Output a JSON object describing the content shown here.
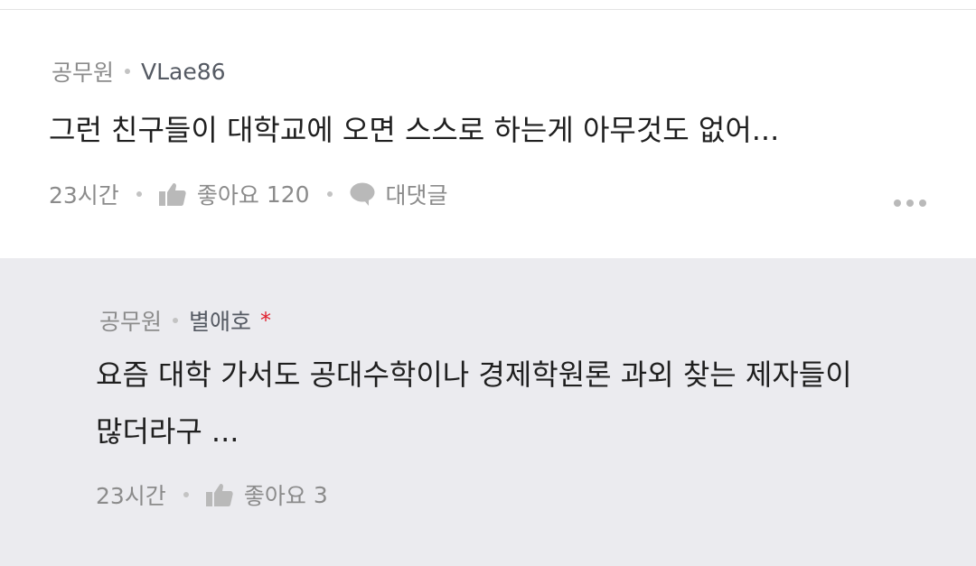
{
  "comments": [
    {
      "category": "공무원",
      "author": "VLae86",
      "text": "그런 친구들이 대학교에 오면 스스로 하는게 아무것도 없어...",
      "time": "23시간",
      "like_label": "좋아요",
      "like_count": "120",
      "reply_label": "대댓글"
    },
    {
      "category": "공무원",
      "author": "별애호",
      "author_mark": "*",
      "text_line1": "요즘 대학 가서도 공대수학이나 경제학원론 과외 찾는 제자들이",
      "text_line2": "많더라구 ...",
      "time": "23시간",
      "like_label": "좋아요",
      "like_count": "3"
    }
  ],
  "icons": {
    "like": "thumbs-up-icon",
    "reply": "speech-bubble-icon",
    "more": "more-options-icon"
  },
  "colors": {
    "reply_background": "#ebebef",
    "meta_text": "#8b8b8b",
    "body_text": "#1f1f1f",
    "mark_red": "#e0202e"
  }
}
